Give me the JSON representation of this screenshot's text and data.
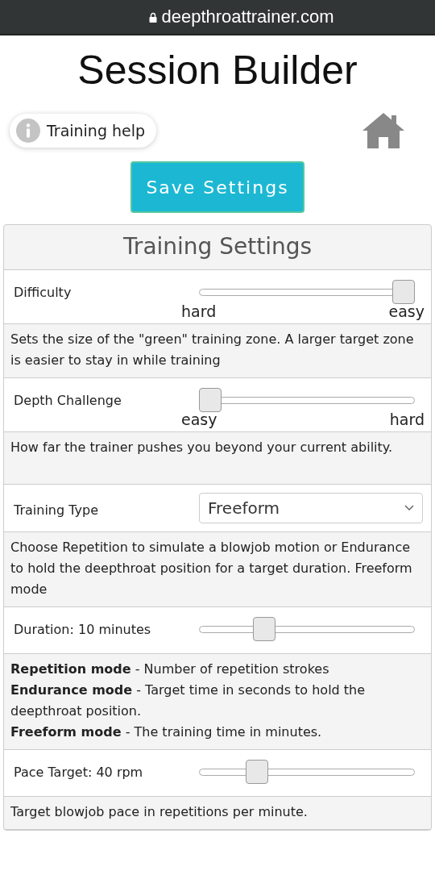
{
  "address_bar": {
    "url": "deepthroattrainer.com"
  },
  "title": "Session Builder",
  "help": {
    "label": "Training help"
  },
  "save_button": "Save Settings",
  "panel": {
    "title": "Training Settings",
    "settings": [
      {
        "kind": "slider",
        "label": "Difficulty",
        "level": 1,
        "min_label": "hard",
        "max_label": "easy",
        "description": [
          "Sets the size of the \"green\" training zone. A larger target zone is easier to stay in while training"
        ]
      },
      {
        "kind": "slider",
        "label": "Depth Challenge",
        "level": 0,
        "min_label": "easy",
        "max_label": "hard",
        "description": [
          "How far the trainer pushes you beyond your current ability."
        ]
      },
      {
        "kind": "select",
        "label": "Training Type",
        "value": "Freeform",
        "description": [
          "Choose Repetition to simulate a blowjob motion or Endurance to hold the deepthroat position for a target duration. Freeform mode"
        ]
      },
      {
        "kind": "slider",
        "label": "Duration: 10 minutes",
        "level": 0.28,
        "description": [
          "**Repetition mode** - Number of repetition strokes",
          "**Endurance mode** - Target time in seconds to hold the deepthroat position.",
          "**Freeform mode** - The training time in minutes."
        ]
      },
      {
        "kind": "slider",
        "label": "Pace Target: 40 rpm",
        "level": 0.24,
        "description": [
          "Target blowjob pace in repetitions per minute."
        ]
      }
    ]
  }
}
